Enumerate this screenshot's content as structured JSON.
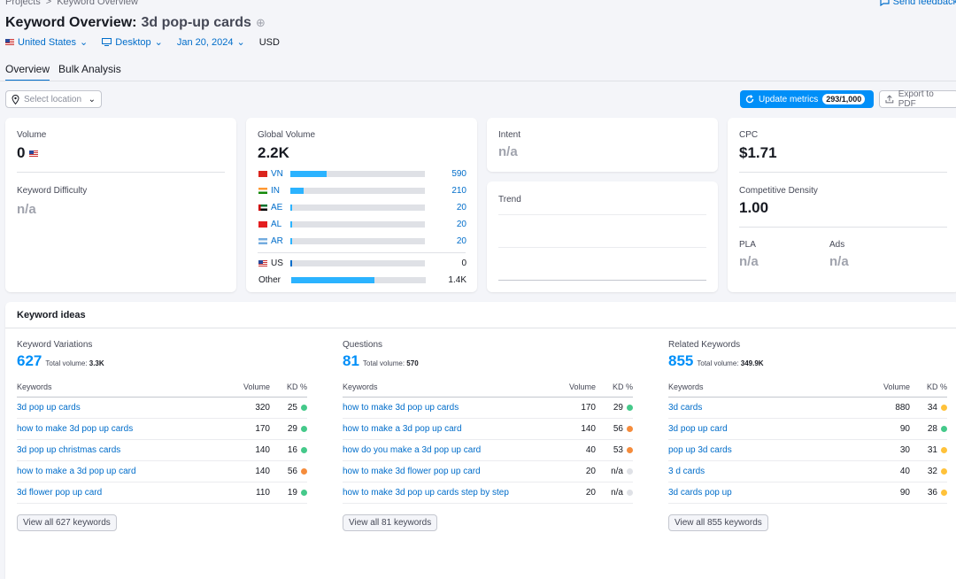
{
  "breadcrumb": {
    "projects": "Projects",
    "sep": ">",
    "current": "Keyword Overview"
  },
  "feedback": "Send feedback",
  "title": {
    "prefix": "Keyword Overview:",
    "query": "3d pop-up cards"
  },
  "filters": {
    "country": "United States",
    "device": "Desktop",
    "date": "Jan 20, 2024",
    "currency": "USD"
  },
  "tabs": [
    "Overview",
    "Bulk Analysis"
  ],
  "location_placeholder": "Select location",
  "update": {
    "label": "Update metrics",
    "count": "293/1,000"
  },
  "export": "Export to PDF",
  "volume": {
    "label": "Volume",
    "value": "0"
  },
  "kd": {
    "label": "Keyword Difficulty",
    "value": "n/a"
  },
  "global": {
    "label": "Global Volume",
    "value": "2.2K",
    "rows": [
      {
        "code": "VN",
        "value": "590",
        "fill": 0.27
      },
      {
        "code": "IN",
        "value": "210",
        "fill": 0.1
      },
      {
        "code": "AE",
        "value": "20",
        "fill": 0.01
      },
      {
        "code": "AL",
        "value": "20",
        "fill": 0.01
      },
      {
        "code": "AR",
        "value": "20",
        "fill": 0.01
      }
    ],
    "us": {
      "code": "US",
      "value": "0",
      "fill": 0.01
    },
    "other": {
      "code": "Other",
      "value": "1.4K",
      "fill": 0.62
    }
  },
  "intent": {
    "label": "Intent",
    "value": "n/a"
  },
  "trend": {
    "label": "Trend"
  },
  "cpc": {
    "label": "CPC",
    "value": "$1.71"
  },
  "density": {
    "label": "Competitive Density",
    "value": "1.00"
  },
  "pla": {
    "label": "PLA",
    "value": "n/a"
  },
  "ads": {
    "label": "Ads",
    "value": "n/a"
  },
  "ideas": {
    "title": "Keyword ideas",
    "headers": {
      "keywords": "Keywords",
      "volume": "Volume",
      "kd": "KD %"
    },
    "variations": {
      "heading": "Keyword Variations",
      "count": "627",
      "total_label": "Total volume:",
      "total": "3.3K",
      "rows": [
        {
          "kw": "3d pop up cards",
          "vol": "320",
          "kd": "25",
          "color": "#45c98a"
        },
        {
          "kw": "how to make 3d pop up cards",
          "vol": "170",
          "kd": "29",
          "color": "#45c98a"
        },
        {
          "kw": "3d pop up christmas cards",
          "vol": "140",
          "kd": "16",
          "color": "#45c98a"
        },
        {
          "kw": "how to make a 3d pop up card",
          "vol": "140",
          "kd": "56",
          "color": "#f58c3c"
        },
        {
          "kw": "3d flower pop up card",
          "vol": "110",
          "kd": "19",
          "color": "#45c98a"
        }
      ],
      "view_all": "View all 627 keywords"
    },
    "questions": {
      "heading": "Questions",
      "count": "81",
      "total_label": "Total volume:",
      "total": "570",
      "rows": [
        {
          "kw": "how to make 3d pop up cards",
          "vol": "170",
          "kd": "29",
          "color": "#45c98a"
        },
        {
          "kw": "how to make a 3d pop up card",
          "vol": "140",
          "kd": "56",
          "color": "#f58c3c"
        },
        {
          "kw": "how do you make a 3d pop up card",
          "vol": "40",
          "kd": "53",
          "color": "#f58c3c"
        },
        {
          "kw": "how to make 3d flower pop up card",
          "vol": "20",
          "kd": "n/a",
          "color": "#dfe1e6"
        },
        {
          "kw": "how to make 3d pop up cards step by step",
          "vol": "20",
          "kd": "n/a",
          "color": "#dfe1e6"
        }
      ],
      "view_all": "View all 81 keywords"
    },
    "related": {
      "heading": "Related Keywords",
      "count": "855",
      "total_label": "Total volume:",
      "total": "349.9K",
      "rows": [
        {
          "kw": "3d cards",
          "vol": "880",
          "kd": "34",
          "color": "#ffc23a"
        },
        {
          "kw": "3d pop up card",
          "vol": "90",
          "kd": "28",
          "color": "#45c98a"
        },
        {
          "kw": "pop up 3d cards",
          "vol": "30",
          "kd": "31",
          "color": "#ffc23a"
        },
        {
          "kw": "3 d cards",
          "vol": "40",
          "kd": "32",
          "color": "#ffc23a"
        },
        {
          "kw": "3d cards pop up",
          "vol": "90",
          "kd": "36",
          "color": "#ffc23a"
        }
      ],
      "view_all": "View all 855 keywords"
    }
  }
}
